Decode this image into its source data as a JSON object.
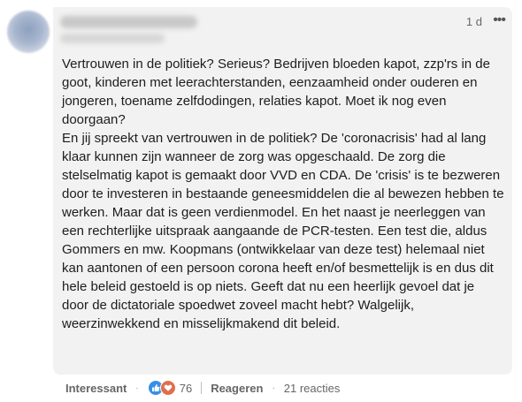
{
  "comment": {
    "timestamp": "1 d",
    "paragraphs": [
      "Vertrouwen in de politiek? Serieus? Bedrijven bloeden kapot, zzp'rs in de goot, kinderen met leerachterstanden, eenzaamheid onder ouderen en jongeren, toename zelfdodingen, relaties kapot. Moet ik nog even doorgaan?",
      "En jij spreekt van vertrouwen in de politiek? De 'coronacrisis' had al lang klaar kunnen zijn wanneer de zorg was opgeschaald. De zorg die stelselmatig kapot is gemaakt door VVD en CDA. De 'crisis' is te bezweren door te investeren in bestaande geneesmiddelen die al bewezen hebben te werken. Maar dat is geen verdienmodel. En het naast je neerleggen van een rechterlijke uitspraak aangaande de PCR-testen. Een test die, aldus Gommers en mw. Koopmans (ontwikkelaar van deze test) helemaal niet kan aantonen of een persoon corona heeft en/of besmettelijk is en dus dit hele beleid gestoeld is op niets. Geeft dat nu een heerlijk gevoel dat je door de dictatoriale spoedwet zoveel macht hebt? Walgelijk, weerzinwekkend en misselijkmakend dit beleid."
    ],
    "more_icon": "•••"
  },
  "actions": {
    "react_label": "Interessant",
    "separator": "·",
    "reaction_icons": [
      "like-icon",
      "love-icon"
    ],
    "reaction_count": "76",
    "reply_label": "Reageren",
    "replies_label": "21 reacties"
  },
  "colors": {
    "bubble": "#f2f2f2",
    "like": "#378fe9",
    "love": "#df704d"
  }
}
